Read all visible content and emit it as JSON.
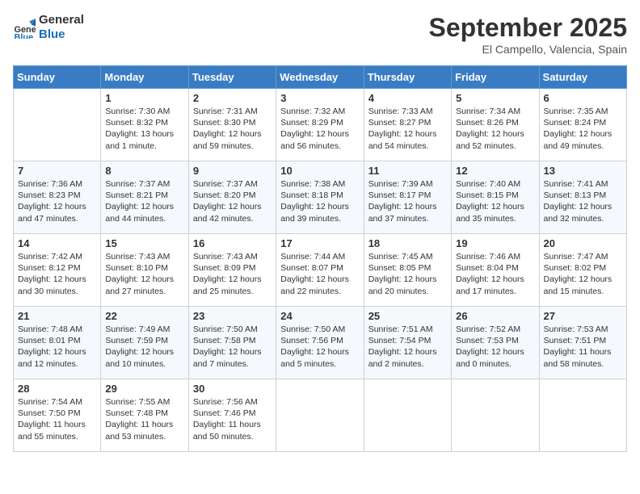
{
  "logo": {
    "line1": "General",
    "line2": "Blue"
  },
  "title": "September 2025",
  "location": "El Campello, Valencia, Spain",
  "days_of_week": [
    "Sunday",
    "Monday",
    "Tuesday",
    "Wednesday",
    "Thursday",
    "Friday",
    "Saturday"
  ],
  "weeks": [
    [
      {
        "day": "",
        "info": ""
      },
      {
        "day": "1",
        "info": "Sunrise: 7:30 AM\nSunset: 8:32 PM\nDaylight: 13 hours\nand 1 minute."
      },
      {
        "day": "2",
        "info": "Sunrise: 7:31 AM\nSunset: 8:30 PM\nDaylight: 12 hours\nand 59 minutes."
      },
      {
        "day": "3",
        "info": "Sunrise: 7:32 AM\nSunset: 8:29 PM\nDaylight: 12 hours\nand 56 minutes."
      },
      {
        "day": "4",
        "info": "Sunrise: 7:33 AM\nSunset: 8:27 PM\nDaylight: 12 hours\nand 54 minutes."
      },
      {
        "day": "5",
        "info": "Sunrise: 7:34 AM\nSunset: 8:26 PM\nDaylight: 12 hours\nand 52 minutes."
      },
      {
        "day": "6",
        "info": "Sunrise: 7:35 AM\nSunset: 8:24 PM\nDaylight: 12 hours\nand 49 minutes."
      }
    ],
    [
      {
        "day": "7",
        "info": "Sunrise: 7:36 AM\nSunset: 8:23 PM\nDaylight: 12 hours\nand 47 minutes."
      },
      {
        "day": "8",
        "info": "Sunrise: 7:37 AM\nSunset: 8:21 PM\nDaylight: 12 hours\nand 44 minutes."
      },
      {
        "day": "9",
        "info": "Sunrise: 7:37 AM\nSunset: 8:20 PM\nDaylight: 12 hours\nand 42 minutes."
      },
      {
        "day": "10",
        "info": "Sunrise: 7:38 AM\nSunset: 8:18 PM\nDaylight: 12 hours\nand 39 minutes."
      },
      {
        "day": "11",
        "info": "Sunrise: 7:39 AM\nSunset: 8:17 PM\nDaylight: 12 hours\nand 37 minutes."
      },
      {
        "day": "12",
        "info": "Sunrise: 7:40 AM\nSunset: 8:15 PM\nDaylight: 12 hours\nand 35 minutes."
      },
      {
        "day": "13",
        "info": "Sunrise: 7:41 AM\nSunset: 8:13 PM\nDaylight: 12 hours\nand 32 minutes."
      }
    ],
    [
      {
        "day": "14",
        "info": "Sunrise: 7:42 AM\nSunset: 8:12 PM\nDaylight: 12 hours\nand 30 minutes."
      },
      {
        "day": "15",
        "info": "Sunrise: 7:43 AM\nSunset: 8:10 PM\nDaylight: 12 hours\nand 27 minutes."
      },
      {
        "day": "16",
        "info": "Sunrise: 7:43 AM\nSunset: 8:09 PM\nDaylight: 12 hours\nand 25 minutes."
      },
      {
        "day": "17",
        "info": "Sunrise: 7:44 AM\nSunset: 8:07 PM\nDaylight: 12 hours\nand 22 minutes."
      },
      {
        "day": "18",
        "info": "Sunrise: 7:45 AM\nSunset: 8:05 PM\nDaylight: 12 hours\nand 20 minutes."
      },
      {
        "day": "19",
        "info": "Sunrise: 7:46 AM\nSunset: 8:04 PM\nDaylight: 12 hours\nand 17 minutes."
      },
      {
        "day": "20",
        "info": "Sunrise: 7:47 AM\nSunset: 8:02 PM\nDaylight: 12 hours\nand 15 minutes."
      }
    ],
    [
      {
        "day": "21",
        "info": "Sunrise: 7:48 AM\nSunset: 8:01 PM\nDaylight: 12 hours\nand 12 minutes."
      },
      {
        "day": "22",
        "info": "Sunrise: 7:49 AM\nSunset: 7:59 PM\nDaylight: 12 hours\nand 10 minutes."
      },
      {
        "day": "23",
        "info": "Sunrise: 7:50 AM\nSunset: 7:58 PM\nDaylight: 12 hours\nand 7 minutes."
      },
      {
        "day": "24",
        "info": "Sunrise: 7:50 AM\nSunset: 7:56 PM\nDaylight: 12 hours\nand 5 minutes."
      },
      {
        "day": "25",
        "info": "Sunrise: 7:51 AM\nSunset: 7:54 PM\nDaylight: 12 hours\nand 2 minutes."
      },
      {
        "day": "26",
        "info": "Sunrise: 7:52 AM\nSunset: 7:53 PM\nDaylight: 12 hours\nand 0 minutes."
      },
      {
        "day": "27",
        "info": "Sunrise: 7:53 AM\nSunset: 7:51 PM\nDaylight: 11 hours\nand 58 minutes."
      }
    ],
    [
      {
        "day": "28",
        "info": "Sunrise: 7:54 AM\nSunset: 7:50 PM\nDaylight: 11 hours\nand 55 minutes."
      },
      {
        "day": "29",
        "info": "Sunrise: 7:55 AM\nSunset: 7:48 PM\nDaylight: 11 hours\nand 53 minutes."
      },
      {
        "day": "30",
        "info": "Sunrise: 7:56 AM\nSunset: 7:46 PM\nDaylight: 11 hours\nand 50 minutes."
      },
      {
        "day": "",
        "info": ""
      },
      {
        "day": "",
        "info": ""
      },
      {
        "day": "",
        "info": ""
      },
      {
        "day": "",
        "info": ""
      }
    ]
  ]
}
